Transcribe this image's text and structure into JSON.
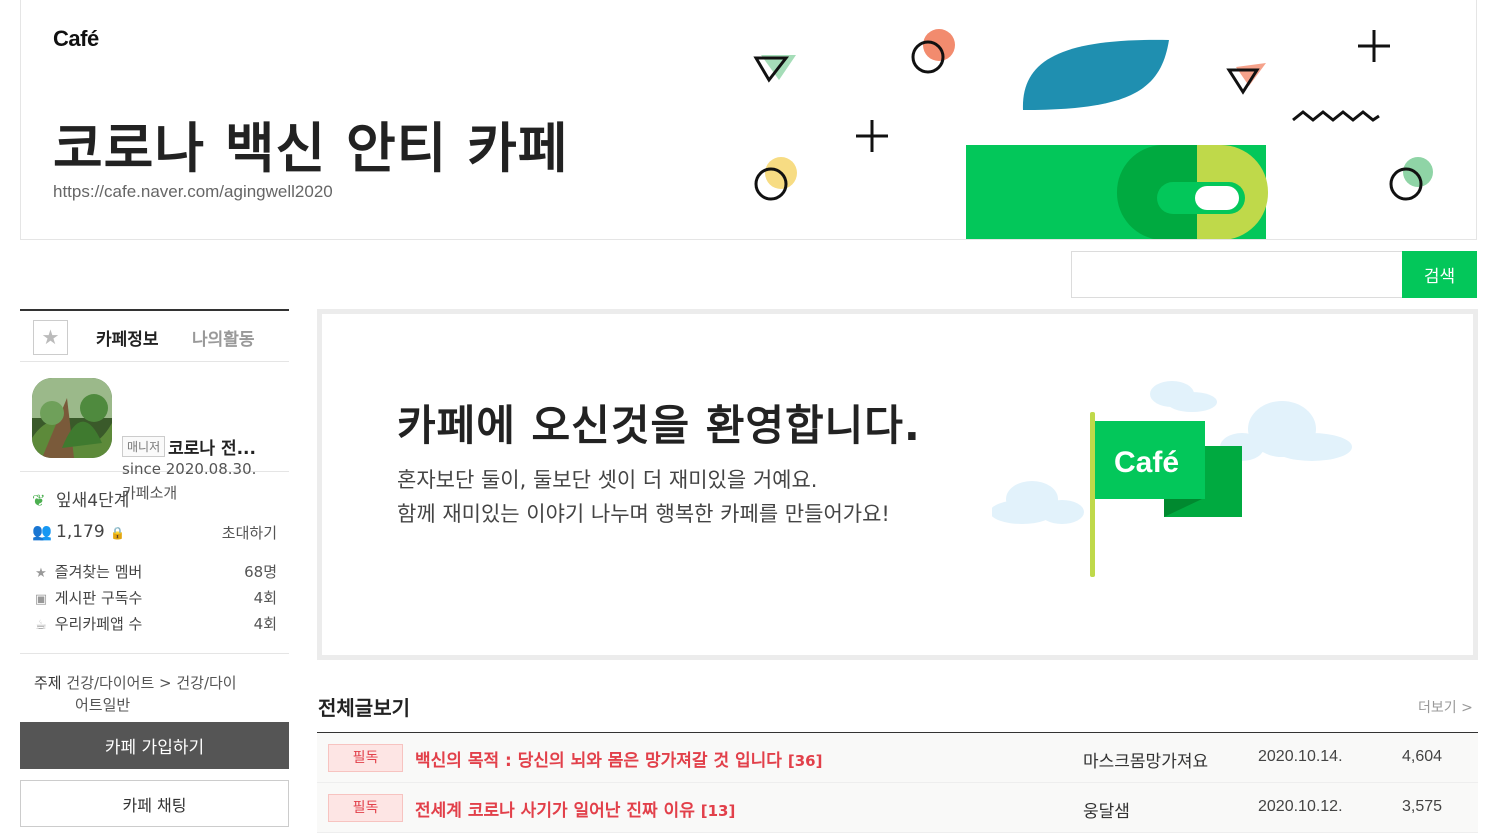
{
  "header": {
    "logo": "Café",
    "title": "코로나 백신 안티 카페",
    "url": "https://cafe.naver.com/agingwell2020"
  },
  "search": {
    "value": "",
    "button_label": "검색"
  },
  "sidebar": {
    "tabs": [
      "카페정보",
      "나의활동"
    ],
    "profile": {
      "manager_badge": "매니저",
      "name": "코로나 전...",
      "since": "since 2020.08.30.",
      "intro_link": "카페소개"
    },
    "level": "잎새4단계",
    "members": {
      "count": "1,179",
      "invite_label": "초대하기"
    },
    "stats": [
      {
        "icon": "star-icon",
        "label": "즐겨찾는 멤버",
        "value": "68명"
      },
      {
        "icon": "rss-icon",
        "label": "게시판 구독수",
        "value": "4회"
      },
      {
        "icon": "app-icon",
        "label": "우리카페앱 수",
        "value": "4회"
      }
    ],
    "topic": {
      "label": "주제",
      "value_line1": "건강/다이어트 > 건강/다이",
      "value_line2": "어트일반"
    },
    "join_button": "카페 가입하기",
    "chat_button": "카페 채팅"
  },
  "welcome": {
    "title": "카페에 오신것을 환영합니다.",
    "line1": "혼자보단 둘이, 둘보단 셋이 더 재미있을 거예요.",
    "line2": "함께 재미있는 이야기 나누며 행복한 카페를 만들어가요!",
    "flag_text": "Café"
  },
  "article_list": {
    "title": "전체글보기",
    "more_label": "더보기 >",
    "rows": [
      {
        "badge": "필독",
        "title": "백신의 목적 : 당신의 뇌와 몸은 망가져갈 것 입니다",
        "comments": "[36]",
        "author": "마스크몸망가져요",
        "date": "2020.10.14.",
        "views": "4,604"
      },
      {
        "badge": "필독",
        "title": "전세계 코로나 사기가 일어난 진짜 이유",
        "comments": "[13]",
        "author": "웅달샘",
        "date": "2020.10.12.",
        "views": "3,575"
      }
    ]
  },
  "colors": {
    "brand_green": "#03c75a",
    "notice_red": "#e2404a",
    "dark_button": "#555555"
  }
}
